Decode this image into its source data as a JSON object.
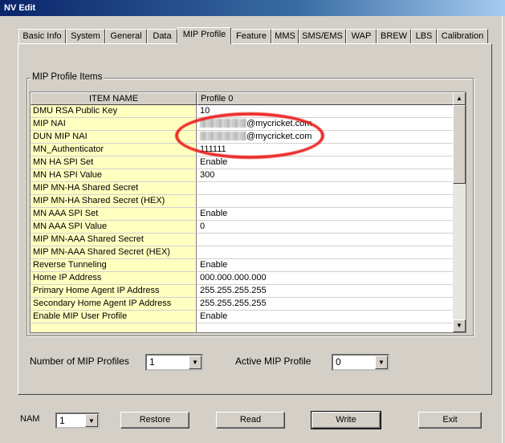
{
  "window": {
    "title": "NV Edit"
  },
  "tabs": [
    {
      "label": "Basic Info",
      "active": false
    },
    {
      "label": "System",
      "active": false
    },
    {
      "label": "General",
      "active": false
    },
    {
      "label": "Data",
      "active": false
    },
    {
      "label": "MIP Profile",
      "active": true
    },
    {
      "label": "Feature",
      "active": false
    },
    {
      "label": "MMS",
      "active": false
    },
    {
      "label": "SMS/EMS",
      "active": false
    },
    {
      "label": "WAP",
      "active": false
    },
    {
      "label": "BREW",
      "active": false
    },
    {
      "label": "LBS",
      "active": false
    },
    {
      "label": "Calibration",
      "active": false
    }
  ],
  "group": {
    "title": "MIP Profile Items"
  },
  "grid": {
    "header_name": "ITEM NAME",
    "header_value": "Profile  0",
    "rows": [
      {
        "name": "DMU RSA Public Key",
        "value": "10"
      },
      {
        "name": "MIP NAI",
        "value": "@mycricket.com",
        "redacted": true
      },
      {
        "name": "DUN MIP NAI",
        "value": "@mycricket.com",
        "redacted": true
      },
      {
        "name": "MN_Authenticator",
        "value": "111111"
      },
      {
        "name": "MN HA SPI Set",
        "value": "Enable"
      },
      {
        "name": "MN HA SPI Value",
        "value": "300"
      },
      {
        "name": "MIP MN-HA Shared Secret",
        "value": ""
      },
      {
        "name": "MIP MN-HA Shared Secret (HEX)",
        "value": ""
      },
      {
        "name": "MN AAA SPI Set",
        "value": "Enable"
      },
      {
        "name": "MN AAA SPI Value",
        "value": "0"
      },
      {
        "name": "MIP MN-AAA Shared Secret",
        "value": ""
      },
      {
        "name": "MIP MN-AAA Shared Secret (HEX)",
        "value": ""
      },
      {
        "name": "Reverse Tunneling",
        "value": "Enable"
      },
      {
        "name": "Home IP Address",
        "value": "000.000.000.000"
      },
      {
        "name": "Primary Home Agent IP Address",
        "value": "255.255.255.255"
      },
      {
        "name": "Secondary Home Agent IP Address",
        "value": "255.255.255.255"
      },
      {
        "name": "Enable MIP User Profile",
        "value": "Enable"
      }
    ]
  },
  "mip_count": {
    "label": "Number of MIP Profiles",
    "value": "1"
  },
  "active_profile": {
    "label": "Active MIP Profile",
    "value": "0"
  },
  "nam": {
    "label": "NAM",
    "value": "1"
  },
  "buttons": {
    "restore": "Restore",
    "read": "Read",
    "write": "Write",
    "exit": "Exit"
  },
  "icons": {
    "scroll_up": "scroll-up-arrow-icon",
    "scroll_down": "scroll-down-arrow-icon",
    "dropdown": "chevron-down-icon"
  },
  "colors": {
    "name_column_bg": "#ffffc0",
    "highlight": "#eb1414"
  }
}
